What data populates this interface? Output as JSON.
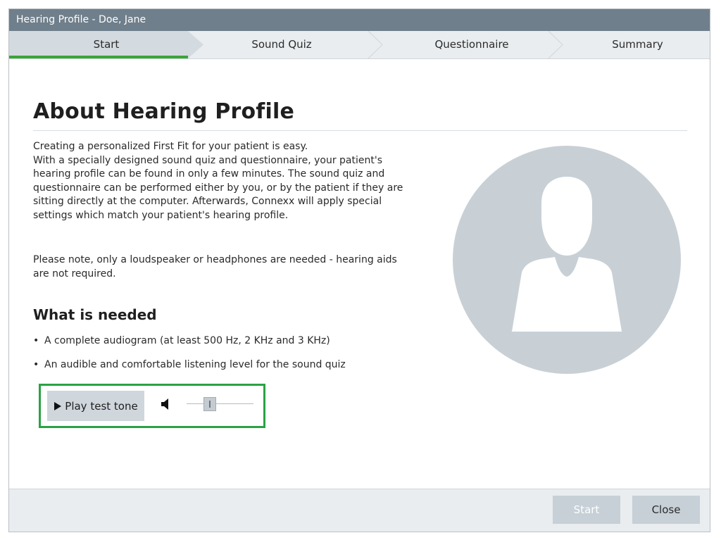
{
  "window": {
    "title": "Hearing Profile - Doe, Jane"
  },
  "wizard": {
    "steps": [
      {
        "label": "Start",
        "active": true
      },
      {
        "label": "Sound Quiz",
        "active": false
      },
      {
        "label": "Questionnaire",
        "active": false
      },
      {
        "label": "Summary",
        "active": false
      }
    ]
  },
  "main": {
    "title": "About Hearing Profile",
    "intro_lines": [
      "Creating a personalized First Fit for your patient is easy.",
      "With a specially designed sound quiz and questionnaire, your patient's",
      "hearing profile can be found in only a few minutes. The sound quiz and",
      "questionnaire can be performed either by you, or by the patient if they are",
      "sitting directly at the computer. Afterwards, Connexx will apply special",
      "settings which match your patient's hearing profile."
    ],
    "note_lines": [
      "Please note, only a loudspeaker or headphones are needed - hearing aids",
      "are not required."
    ],
    "needed_title": "What is needed",
    "needed_items": [
      "A complete audiogram (at least 500 Hz, 2 KHz and 3 KHz)",
      "An audible and comfortable listening level for the sound quiz"
    ],
    "play_button_label": "Play test tone",
    "volume_level": 0.35,
    "avatar_icon": "user-silhouette-icon"
  },
  "footer": {
    "start_label": "Start",
    "close_label": "Close"
  },
  "colors": {
    "titlebar": "#6f7f8b",
    "active_step_underline": "#3aa537",
    "highlight_border": "#2aa344",
    "avatar_circle": "#c8d0d6"
  }
}
